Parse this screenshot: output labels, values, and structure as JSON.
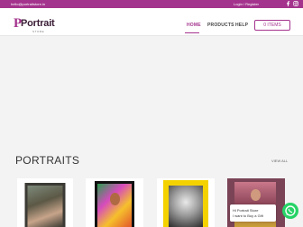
{
  "topbar": {
    "email": "hello@portraitstore.in",
    "account": "Login / Register",
    "social": [
      {
        "icon": "facebook-icon"
      },
      {
        "icon": "instagram-icon"
      }
    ]
  },
  "header": {
    "logo": {
      "main": "Portrait",
      "sub": "STORE"
    },
    "nav": {
      "home": "HOME",
      "products": "PRODUCTS",
      "help": "HELP"
    },
    "cart_label": "0 ITEMS"
  },
  "section": {
    "title": "PORTRAITS",
    "view_all": "VIEW ALL"
  },
  "chat": {
    "line1": "Hi Portrait Store",
    "line2": "I want to Buy a Gift"
  },
  "colors": {
    "accent": "#a4338d",
    "whatsapp": "#25d366"
  }
}
